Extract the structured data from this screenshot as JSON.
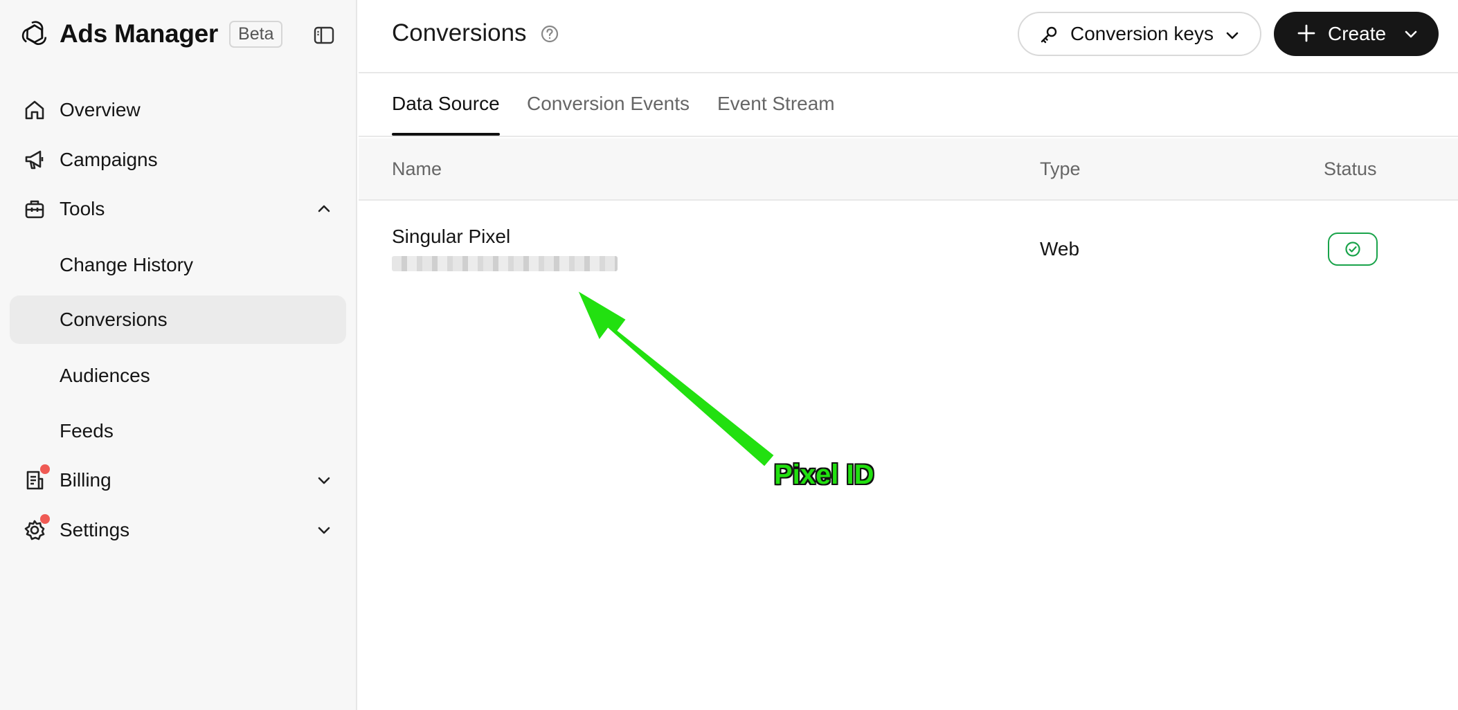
{
  "app": {
    "name": "Ads Manager",
    "badge": "Beta"
  },
  "sidebar": {
    "items": [
      {
        "label": "Overview"
      },
      {
        "label": "Campaigns"
      },
      {
        "label": "Tools"
      },
      {
        "label": "Change History"
      },
      {
        "label": "Conversions",
        "active": true
      },
      {
        "label": "Audiences"
      },
      {
        "label": "Feeds"
      },
      {
        "label": "Billing",
        "notification": true
      },
      {
        "label": "Settings",
        "notification": true
      }
    ]
  },
  "header": {
    "title": "Conversions",
    "keys_button": "Conversion keys",
    "create_button": "Create"
  },
  "tabs": [
    {
      "label": "Data Source",
      "active": true
    },
    {
      "label": "Conversion Events"
    },
    {
      "label": "Event Stream"
    }
  ],
  "table": {
    "columns": [
      "Name",
      "Type",
      "Status"
    ],
    "rows": [
      {
        "name": "Singular Pixel",
        "type": "Web",
        "status": "active"
      }
    ]
  },
  "annotation": {
    "label": "Pixel ID",
    "color": "#22e010"
  },
  "colors": {
    "accent_dark": "#161616",
    "status_green": "#19a34a",
    "notification": "#ef5a54"
  }
}
